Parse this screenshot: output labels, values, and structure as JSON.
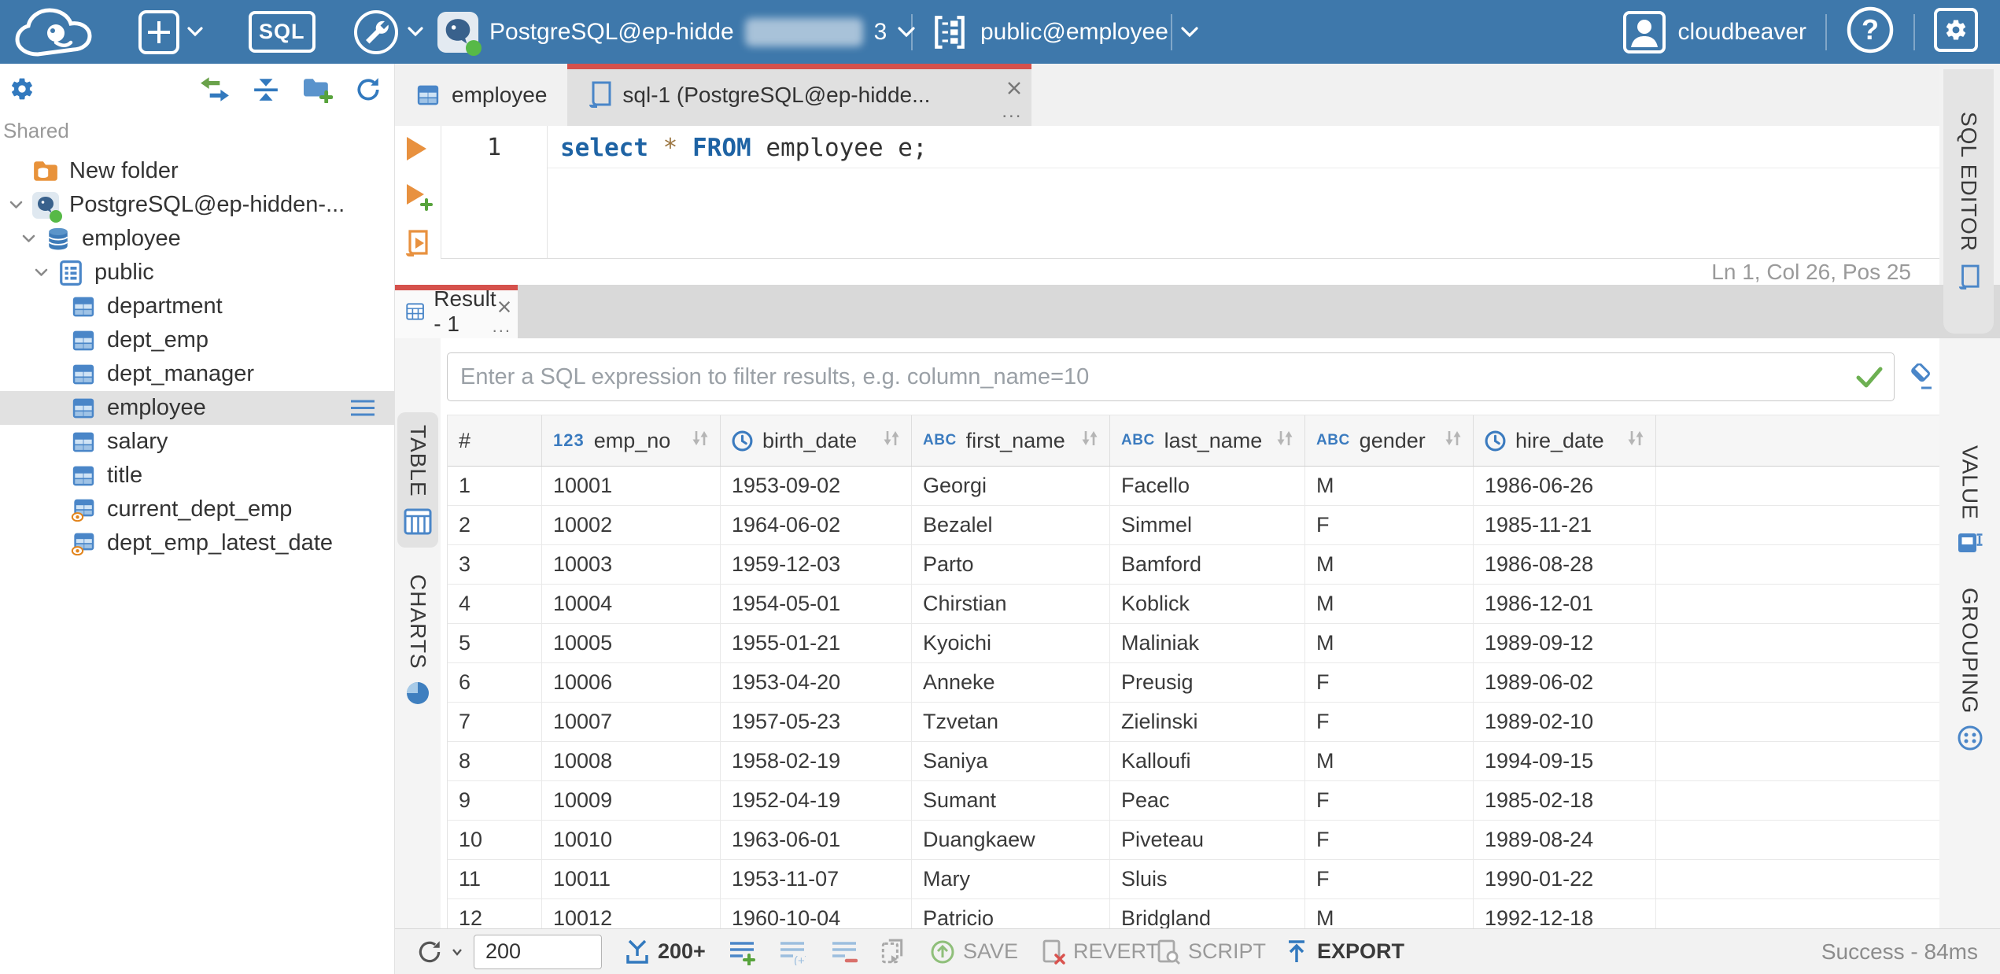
{
  "topbar": {
    "sql_badge": "SQL",
    "connection_label": "PostgreSQL@ep-hidde",
    "connection_suffix": "3",
    "schema_label": "public@employee",
    "user_label": "cloudbeaver"
  },
  "sidebar": {
    "section_label": "Shared",
    "items": [
      {
        "label": "New folder",
        "icon": "folderdb",
        "depth": 0,
        "expandable": false
      },
      {
        "label": "PostgreSQL@ep-hidden-...",
        "icon": "postgres",
        "depth": 0,
        "expandable": true,
        "status_dot": true
      },
      {
        "label": "employee",
        "icon": "database",
        "depth": 1,
        "expandable": true
      },
      {
        "label": "public",
        "icon": "schema",
        "depth": 2,
        "expandable": true
      },
      {
        "label": "department",
        "icon": "table",
        "depth": 3
      },
      {
        "label": "dept_emp",
        "icon": "table",
        "depth": 3
      },
      {
        "label": "dept_manager",
        "icon": "table",
        "depth": 3
      },
      {
        "label": "employee",
        "icon": "table",
        "depth": 3,
        "selected": true
      },
      {
        "label": "salary",
        "icon": "table",
        "depth": 3
      },
      {
        "label": "title",
        "icon": "table",
        "depth": 3
      },
      {
        "label": "current_dept_emp",
        "icon": "view",
        "depth": 3
      },
      {
        "label": "dept_emp_latest_date",
        "icon": "view",
        "depth": 3
      }
    ]
  },
  "tabs": {
    "table_tab": "employee",
    "sql_tab": "sql-1 (PostgreSQL@ep-hidde..."
  },
  "ui": {
    "more_dots": "..."
  },
  "editor": {
    "line_number": "1",
    "code": [
      {
        "t": "select",
        "c": "kw"
      },
      {
        "t": " ",
        "c": "pl"
      },
      {
        "t": "*",
        "c": "op"
      },
      {
        "t": " ",
        "c": "pl"
      },
      {
        "t": "FROM",
        "c": "kw"
      },
      {
        "t": " employee e;",
        "c": "pl"
      }
    ],
    "status": "Ln 1, Col 26, Pos 25",
    "rail_label": "SQL EDITOR"
  },
  "result": {
    "tab_label": "Result - 1",
    "filter_placeholder": "Enter a SQL expression to filter results, e.g. column_name=10",
    "left_tabs": [
      {
        "label": "TABLE",
        "selected": true
      },
      {
        "label": "CHARTS",
        "selected": false
      }
    ],
    "right_tabs": [
      {
        "label": "VALUE"
      },
      {
        "label": "GROUPING"
      }
    ]
  },
  "grid": {
    "columns": [
      {
        "name": "#",
        "type": "index"
      },
      {
        "name": "emp_no",
        "type": "number"
      },
      {
        "name": "birth_date",
        "type": "date"
      },
      {
        "name": "first_name",
        "type": "string"
      },
      {
        "name": "last_name",
        "type": "string"
      },
      {
        "name": "gender",
        "type": "string"
      },
      {
        "name": "hire_date",
        "type": "date"
      }
    ],
    "rows": [
      [
        "1",
        "10001",
        "1953-09-02",
        "Georgi",
        "Facello",
        "M",
        "1986-06-26"
      ],
      [
        "2",
        "10002",
        "1964-06-02",
        "Bezalel",
        "Simmel",
        "F",
        "1985-11-21"
      ],
      [
        "3",
        "10003",
        "1959-12-03",
        "Parto",
        "Bamford",
        "M",
        "1986-08-28"
      ],
      [
        "4",
        "10004",
        "1954-05-01",
        "Chirstian",
        "Koblick",
        "M",
        "1986-12-01"
      ],
      [
        "5",
        "10005",
        "1955-01-21",
        "Kyoichi",
        "Maliniak",
        "M",
        "1989-09-12"
      ],
      [
        "6",
        "10006",
        "1953-04-20",
        "Anneke",
        "Preusig",
        "F",
        "1989-06-02"
      ],
      [
        "7",
        "10007",
        "1957-05-23",
        "Tzvetan",
        "Zielinski",
        "F",
        "1989-02-10"
      ],
      [
        "8",
        "10008",
        "1958-02-19",
        "Saniya",
        "Kalloufi",
        "M",
        "1994-09-15"
      ],
      [
        "9",
        "10009",
        "1952-04-19",
        "Sumant",
        "Peac",
        "F",
        "1985-02-18"
      ],
      [
        "10",
        "10010",
        "1963-06-01",
        "Duangkaew",
        "Piveteau",
        "F",
        "1989-08-24"
      ],
      [
        "11",
        "10011",
        "1953-11-07",
        "Mary",
        "Sluis",
        "F",
        "1990-01-22"
      ],
      [
        "12",
        "10012",
        "1960-10-04",
        "Patricio",
        "Bridgland",
        "M",
        "1992-12-18"
      ]
    ]
  },
  "toolbar": {
    "row_limit_value": "200",
    "fetch_size_label": "200+",
    "save_label": "SAVE",
    "revert_label": "REVERT",
    "script_label": "SCRIPT",
    "export_label": "EXPORT",
    "status_message": "Success - 84ms"
  },
  "colors": {
    "topbar_blue": "#3e78ab",
    "accent_red": "#d5514c",
    "icon_blue": "#4a86c8",
    "status_green": "#57b947"
  }
}
